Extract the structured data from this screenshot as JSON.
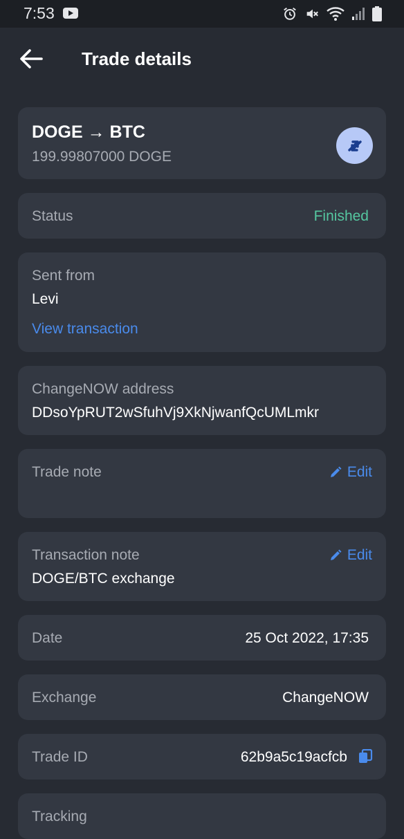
{
  "status_bar": {
    "time": "7:53"
  },
  "header": {
    "title": "Trade details"
  },
  "trade": {
    "pair": "DOGE → BTC",
    "amount": "199.99807000 DOGE"
  },
  "status": {
    "label": "Status",
    "value": "Finished",
    "value_color": "#55c7a0"
  },
  "sent_from": {
    "label": "Sent from",
    "value": "Levi",
    "link": "View transaction"
  },
  "changenow_address": {
    "label": "ChangeNOW address",
    "value": "DDsoYpRUT2wSfuhVj9XkNjwanfQcUMLmkr"
  },
  "trade_note": {
    "label": "Trade note",
    "edit": "Edit",
    "value": ""
  },
  "transaction_note": {
    "label": "Transaction note",
    "edit": "Edit",
    "value": "DOGE/BTC exchange"
  },
  "date": {
    "label": "Date",
    "value": "25 Oct 2022, 17:35"
  },
  "exchange": {
    "label": "Exchange",
    "value": "ChangeNOW"
  },
  "trade_id": {
    "label": "Trade ID",
    "value": "62b9a5c19acfcb"
  },
  "tracking": {
    "label": "Tracking"
  },
  "colors": {
    "background": "#272b33",
    "card": "#333842",
    "accent": "#4a8bec",
    "success": "#55c7a0"
  }
}
